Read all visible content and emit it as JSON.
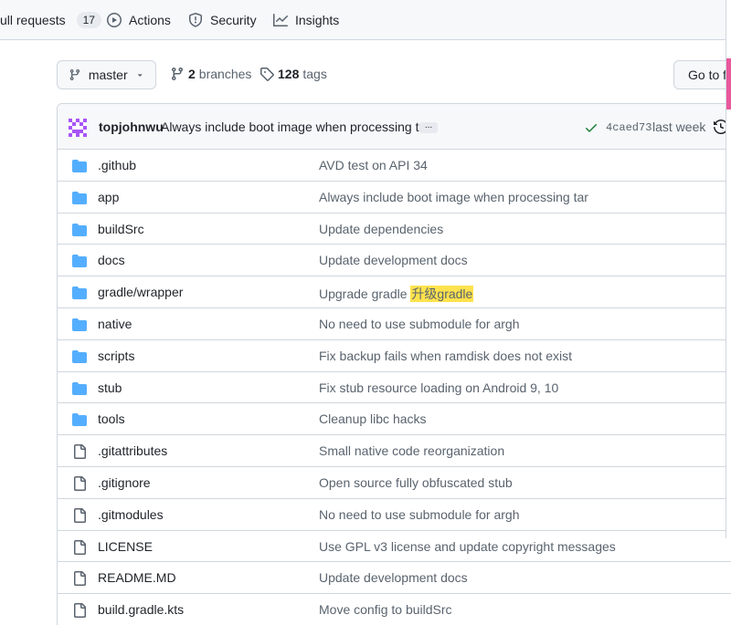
{
  "nav": {
    "pull_requests_label": "ull requests",
    "pull_requests_count": "17",
    "actions_label": "Actions",
    "security_label": "Security",
    "insights_label": "Insights"
  },
  "branch": {
    "selected": "master",
    "branches_count": "2",
    "branches_label": "branches",
    "tags_count": "128",
    "tags_label": "tags",
    "goto_label": "Go to f"
  },
  "commit": {
    "author": "topjohnwu",
    "message": "Always include boot image when processing tar",
    "ellipsis": "...",
    "sha": "4caed73",
    "time": "last week",
    "status_color": "#1a7f37"
  },
  "files": [
    {
      "type": "folder",
      "name": ".github",
      "message": "AVD test on API 34"
    },
    {
      "type": "folder",
      "name": "app",
      "message": "Always include boot image when processing tar"
    },
    {
      "type": "folder",
      "name": "buildSrc",
      "message": "Update dependencies"
    },
    {
      "type": "folder",
      "name": "docs",
      "message": "Update development docs"
    },
    {
      "type": "folder",
      "name": "gradle/wrapper",
      "message": "Upgrade gradle ",
      "highlight": "升级gradle"
    },
    {
      "type": "folder",
      "name": "native",
      "message": "No need to use submodule for argh"
    },
    {
      "type": "folder",
      "name": "scripts",
      "message": "Fix backup fails when ramdisk does not exist"
    },
    {
      "type": "folder",
      "name": "stub",
      "message": "Fix stub resource loading on Android 9, 10"
    },
    {
      "type": "folder",
      "name": "tools",
      "message": "Cleanup libc hacks"
    },
    {
      "type": "file",
      "name": ".gitattributes",
      "message": "Small native code reorganization"
    },
    {
      "type": "file",
      "name": ".gitignore",
      "message": "Open source fully obfuscated stub"
    },
    {
      "type": "file",
      "name": ".gitmodules",
      "message": "No need to use submodule for argh"
    },
    {
      "type": "file",
      "name": "LICENSE",
      "message": "Use GPL v3 license and update copyright messages"
    },
    {
      "type": "file",
      "name": "README.MD",
      "message": "Update development docs"
    },
    {
      "type": "file",
      "name": "build.gradle.kts",
      "message": "Move config to buildSrc"
    }
  ],
  "colors": {
    "folder": "#54aeff",
    "file_icon": "#59636e",
    "highlight": "#ffe24d",
    "accent_mark": "#e9579c"
  }
}
